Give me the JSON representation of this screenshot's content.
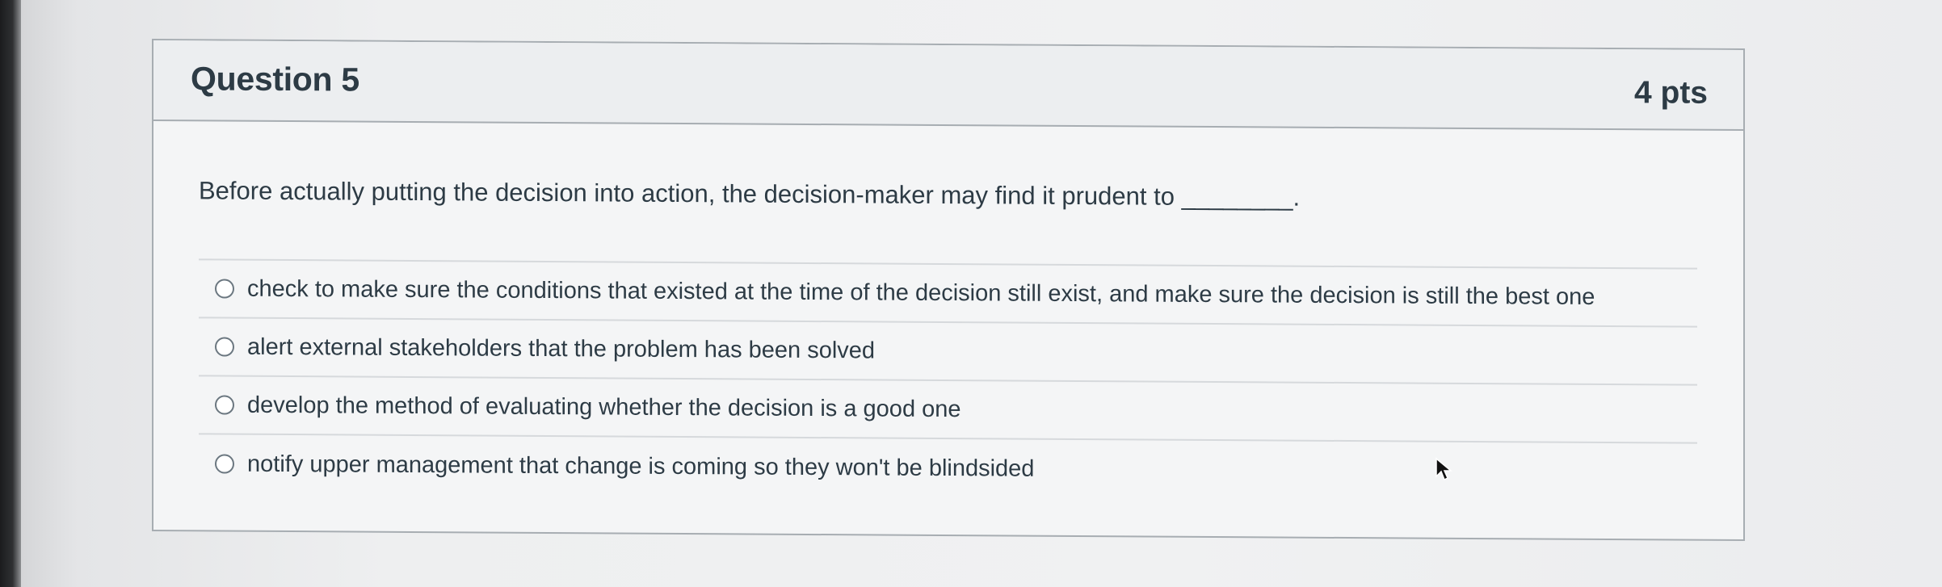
{
  "question": {
    "title": "Question 5",
    "points": "4 pts",
    "text": "Before actually putting the decision into action, the decision-maker may find it prudent to ________."
  },
  "answers": [
    {
      "label": "check to make sure the conditions that existed at the time of the decision still exist, and make sure the decision is still the best one",
      "selected": false
    },
    {
      "label": "alert external stakeholders that the problem has been solved",
      "selected": false
    },
    {
      "label": "develop the method of evaluating whether the decision is a good one",
      "selected": false
    },
    {
      "label": "notify upper management that change is coming so they won't be blindsided",
      "selected": false
    }
  ]
}
